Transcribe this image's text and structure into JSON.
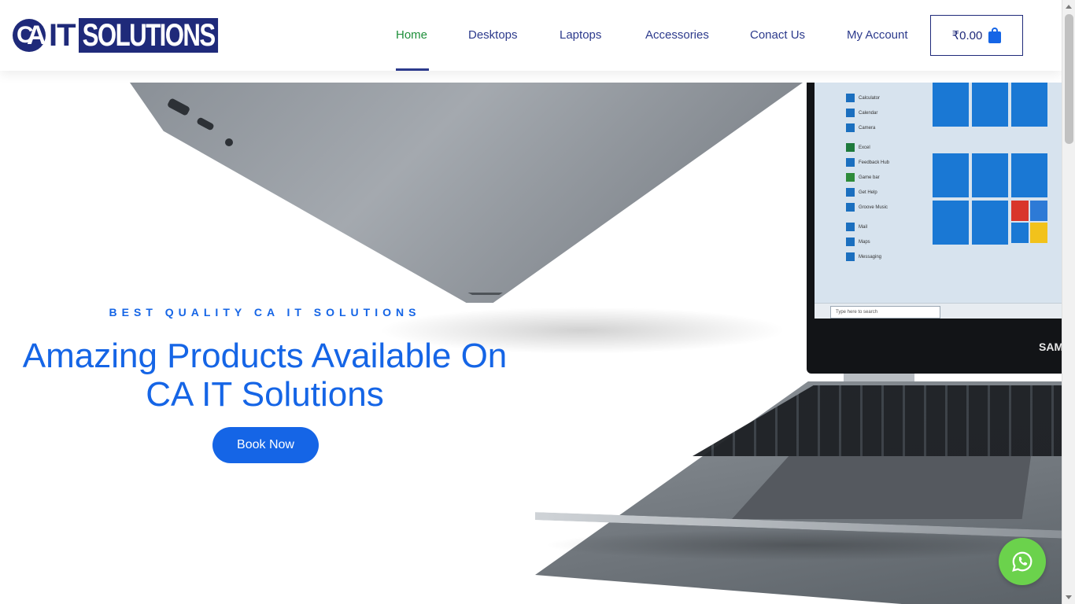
{
  "header": {
    "logo": {
      "mark_c": "C",
      "mark_a": "A",
      "it": "IT",
      "solutions": "SOLUTIONS"
    },
    "nav": [
      {
        "label": "Home",
        "active": true
      },
      {
        "label": "Desktops",
        "active": false
      },
      {
        "label": "Laptops",
        "active": false
      },
      {
        "label": "Accessories",
        "active": false
      },
      {
        "label": "Conact Us",
        "active": false
      },
      {
        "label": "My Account",
        "active": false
      }
    ],
    "cart": {
      "total": "₹0.00",
      "icon": "shopping-bag-icon"
    }
  },
  "hero": {
    "eyebrow": "BEST QUALITY CA IT SOLUTIONS",
    "headline_line1": "Amazing Products Available On",
    "headline_line2": "CA IT Solutions",
    "cta_label": "Book Now",
    "laptop_brand": "SAM",
    "screen": {
      "taskbar_search": "Type here to search",
      "start_apps": [
        "Calculator",
        "Calendar",
        "Camera",
        "Excel",
        "Feedback Hub",
        "Game bar",
        "Get Help",
        "Groove Music",
        "Mail",
        "Maps",
        "Messaging"
      ]
    }
  },
  "floating": {
    "whatsapp_icon": "whatsapp-icon"
  },
  "colors": {
    "primary": "#1565e6",
    "brand_navy": "#1f2a7a",
    "nav_text": "#2c3a8c",
    "active_nav": "#1e8f3a",
    "whatsapp": "#6bd24c"
  }
}
